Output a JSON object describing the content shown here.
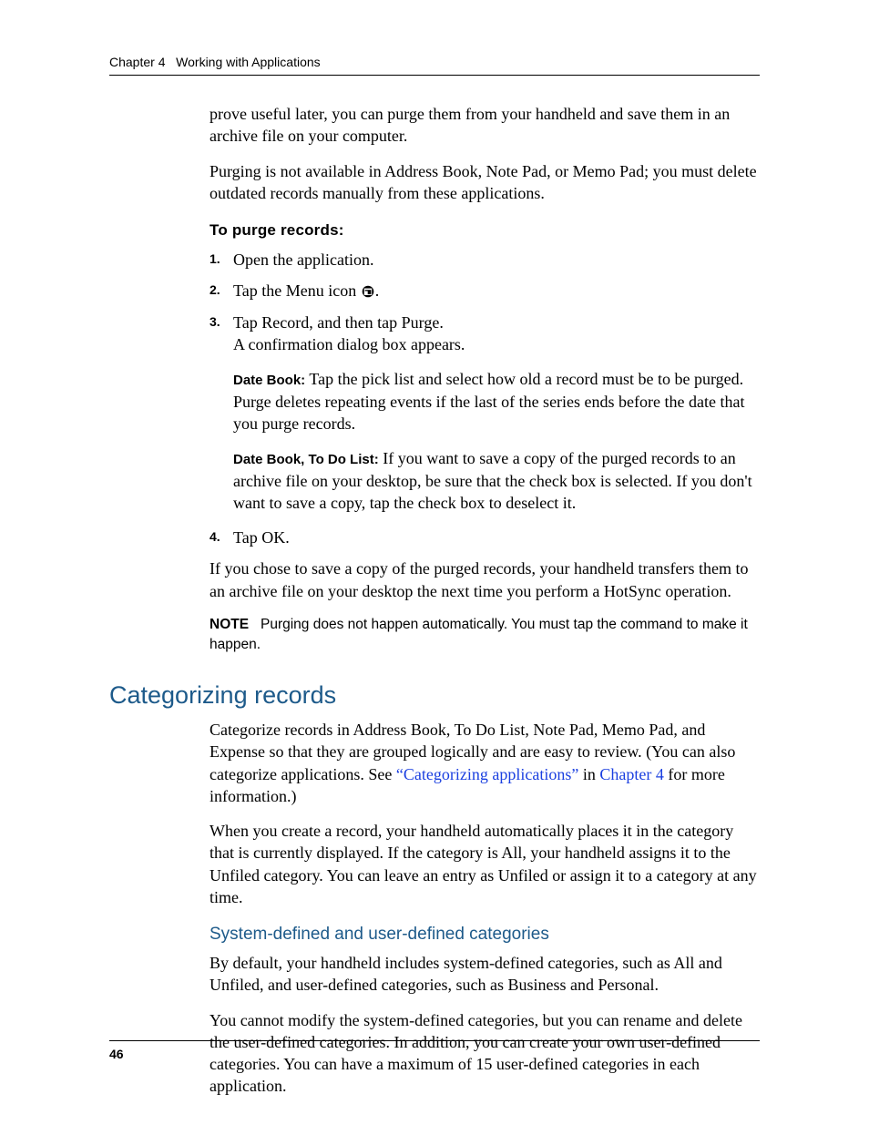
{
  "header": {
    "chapter": "Chapter 4",
    "title": "Working with Applications"
  },
  "intro": {
    "p1": "prove useful later, you can purge them from your handheld and save them in an archive file on your computer.",
    "p2": "Purging is not available in Address Book, Note Pad, or Memo Pad; you must delete outdated records manually from these applications."
  },
  "procedure": {
    "heading": "To purge records:",
    "steps": {
      "s1": {
        "num": "1.",
        "text": "Open the application."
      },
      "s2": {
        "num": "2.",
        "prefix": "Tap the Menu icon ",
        "suffix": "."
      },
      "s3": {
        "num": "3.",
        "text": "Tap Record, and then tap Purge.",
        "sub1": "A confirmation dialog box appears.",
        "sub2_label": "Date Book:",
        "sub2_text": " Tap the pick list and select how old a record must be to be purged. Purge deletes repeating events if the last of the series ends before the date that you purge records.",
        "sub3_label": "Date Book, To Do List:",
        "sub3_text": " If you want to save a copy of the purged records to an archive file on your desktop, be sure that the check box is selected. If you don't want to save a copy, tap the check box to deselect it."
      },
      "s4": {
        "num": "4.",
        "text": "Tap OK."
      }
    },
    "after": "If you chose to save a copy of the purged records, your handheld transfers them to an archive file on your desktop the next time you perform a HotSync operation.",
    "note_label": "NOTE",
    "note_text": "Purging does not happen automatically. You must tap the command to make it happen."
  },
  "section": {
    "heading": "Categorizing records",
    "p1_a": "Categorize records in Address Book, To Do List, Note Pad, Memo Pad, and Expense so that they are grouped logically and are easy to review. (You can also categorize applications. See ",
    "p1_link1": "“Categorizing applications”",
    "p1_b": " in ",
    "p1_link2": "Chapter 4",
    "p1_c": " for more information.)",
    "p2": "When you create a record, your handheld automatically places it in the category that is currently displayed. If the category is All, your handheld assigns it to the Unfiled category. You can leave an entry as Unfiled or assign it to a category at any time.",
    "sub_heading": "System-defined and user-defined categories",
    "p3": "By default, your handheld includes system-defined categories, such as All and Unfiled, and user-defined categories, such as Business and Personal.",
    "p4": "You cannot modify the system-defined categories, but you can rename and delete the user-defined categories. In addition, you can create your own user-defined categories. You can have a maximum of 15 user-defined categories in each application."
  },
  "page_number": "46"
}
